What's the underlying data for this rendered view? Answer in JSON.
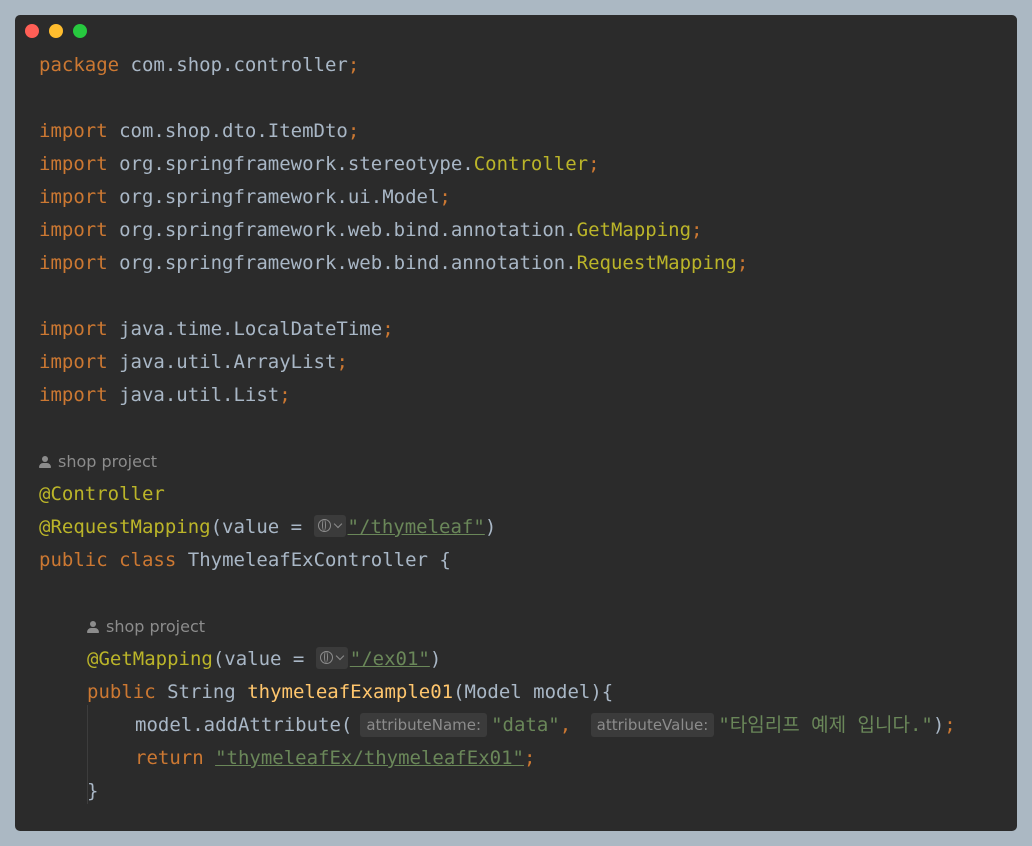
{
  "window": {
    "controls": [
      "close",
      "minimize",
      "maximize"
    ],
    "colors": {
      "close": "#ff5f56",
      "minimize": "#ffbd2e",
      "maximize": "#27c93f"
    }
  },
  "code": {
    "package_kw": "package",
    "package_name": "com.shop.controller",
    "semicolon": ";",
    "import_kw": "import",
    "imports": [
      {
        "prefix": "com.shop.dto.ItemDto",
        "cls": ""
      },
      {
        "prefix": "org.springframework.stereotype.",
        "cls": "Controller"
      },
      {
        "prefix": "org.springframework.ui.Model",
        "cls": ""
      },
      {
        "prefix": "org.springframework.web.bind.annotation.",
        "cls": "GetMapping"
      },
      {
        "prefix": "org.springframework.web.bind.annotation.",
        "cls": "RequestMapping"
      },
      {
        "prefix": "java.time.LocalDateTime",
        "cls": ""
      },
      {
        "prefix": "java.util.ArrayList",
        "cls": ""
      },
      {
        "prefix": "java.util.List",
        "cls": ""
      }
    ],
    "author_hint": "shop project",
    "class_annotation": "@Controller",
    "request_mapping": {
      "annotation": "@RequestMapping",
      "open": "(value = ",
      "path": "\"/thymeleaf\"",
      "close": ")"
    },
    "class_decl": {
      "public_kw": "public",
      "class_kw": "class",
      "name": "ThymeleafExController {"
    },
    "method_author_hint": "shop project",
    "get_mapping": {
      "annotation": "@GetMapping",
      "open": "(value = ",
      "path": "\"/ex01\"",
      "close": ")"
    },
    "method_decl": {
      "public_kw": "public",
      "return_type": "String",
      "name": "thymeleafExample01",
      "params": "(Model model){"
    },
    "add_attribute": {
      "call": "model.addAttribute(",
      "hint_name": "attributeName:",
      "arg_name": "\"data\"",
      "comma": ",",
      "hint_value": "attributeValue:",
      "arg_value": "\"타임리프 예제 입니다.\"",
      "close": ")"
    },
    "return_stmt": {
      "kw": "return",
      "value": "\"thymeleafEx/thymeleafEx01\""
    },
    "method_close": "}"
  }
}
